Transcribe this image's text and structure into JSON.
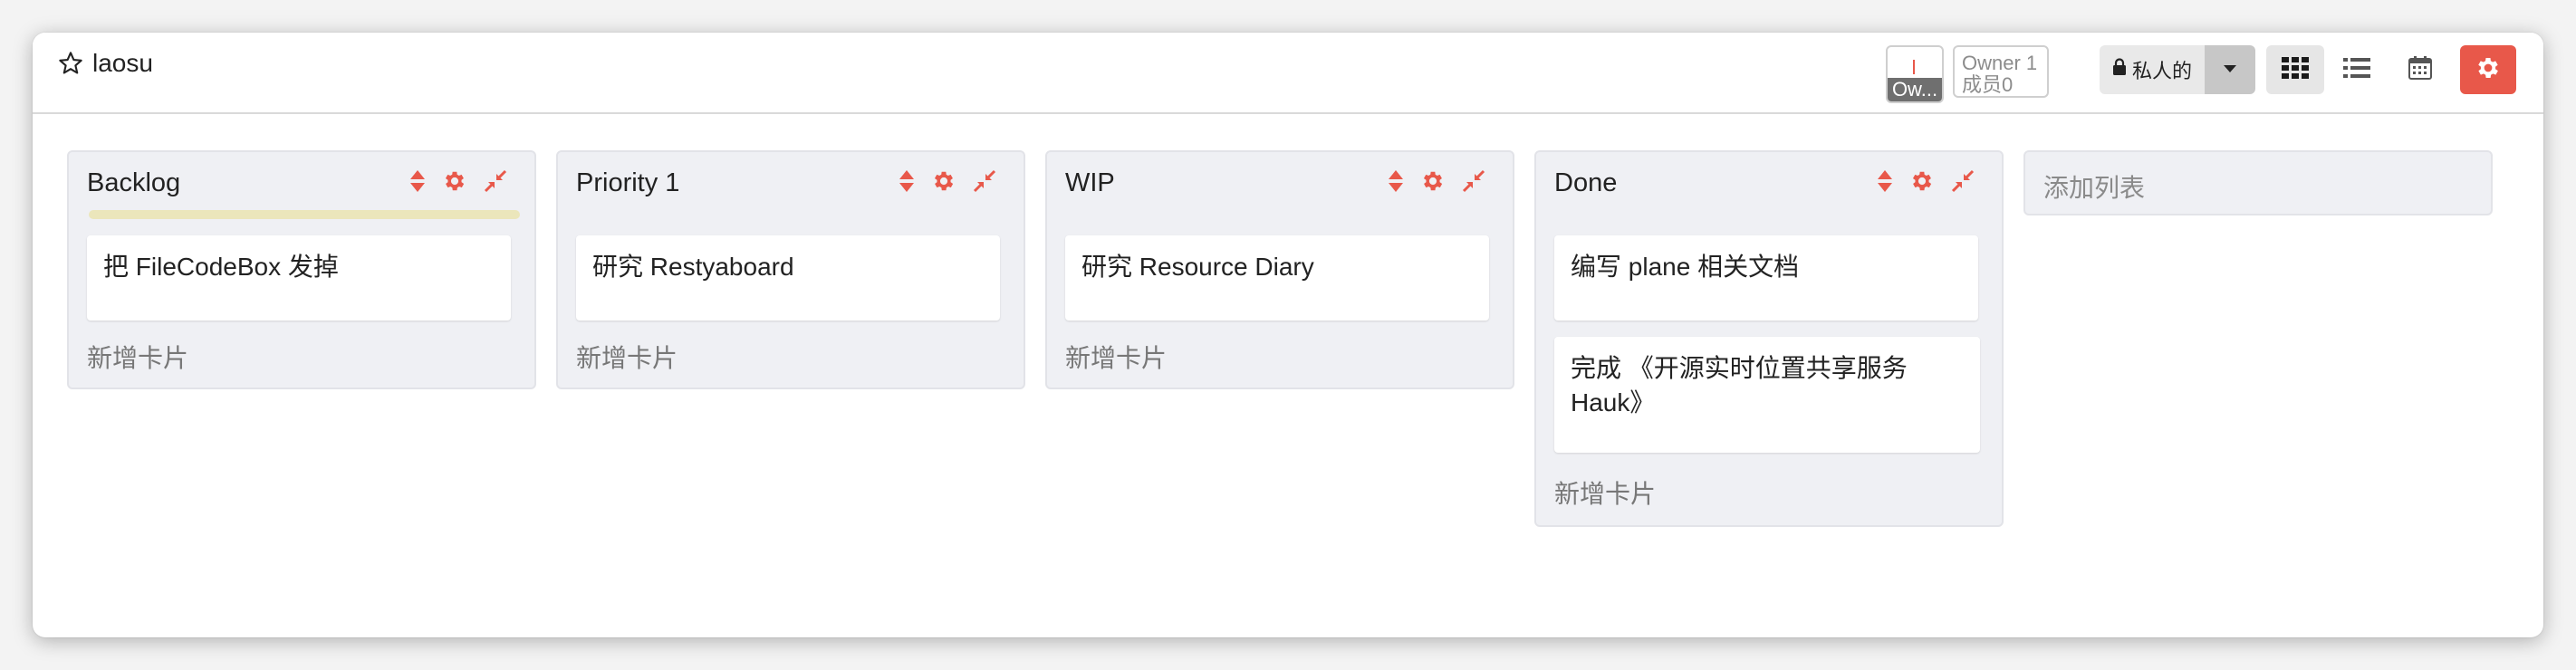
{
  "board": {
    "title": "laosu"
  },
  "toolbar": {
    "member_avatar_label": "Ow...",
    "owner_label": "Owner 1",
    "members_label": "成员0",
    "privacy_label": "私人的",
    "views": [
      {
        "name": "board-view",
        "icon": "grid-icon"
      },
      {
        "name": "list-view",
        "icon": "list-icon"
      },
      {
        "name": "calendar-view",
        "icon": "calendar-icon"
      },
      {
        "name": "board-settings",
        "icon": "gear-icon"
      }
    ]
  },
  "lists": [
    {
      "title": "Backlog",
      "cards": [
        "把 FileCodeBox 发掉"
      ],
      "add_card": "新增卡片",
      "progress": 1.0
    },
    {
      "title": "Priority 1",
      "cards": [
        "研究 Restyaboard"
      ],
      "add_card": "新增卡片"
    },
    {
      "title": "WIP",
      "cards": [
        "研究 Resource Diary"
      ],
      "add_card": "新增卡片"
    },
    {
      "title": "Done",
      "cards": [
        "编写 plane 相关文档",
        "完成 《开源实时位置共享服务 Hauk》"
      ],
      "add_card": "新增卡片"
    }
  ],
  "add_list": "添加列表",
  "colors": {
    "accent": "#e8584a",
    "list_bg": "#eff0f4",
    "progress_bar": "#ebe6bb"
  }
}
